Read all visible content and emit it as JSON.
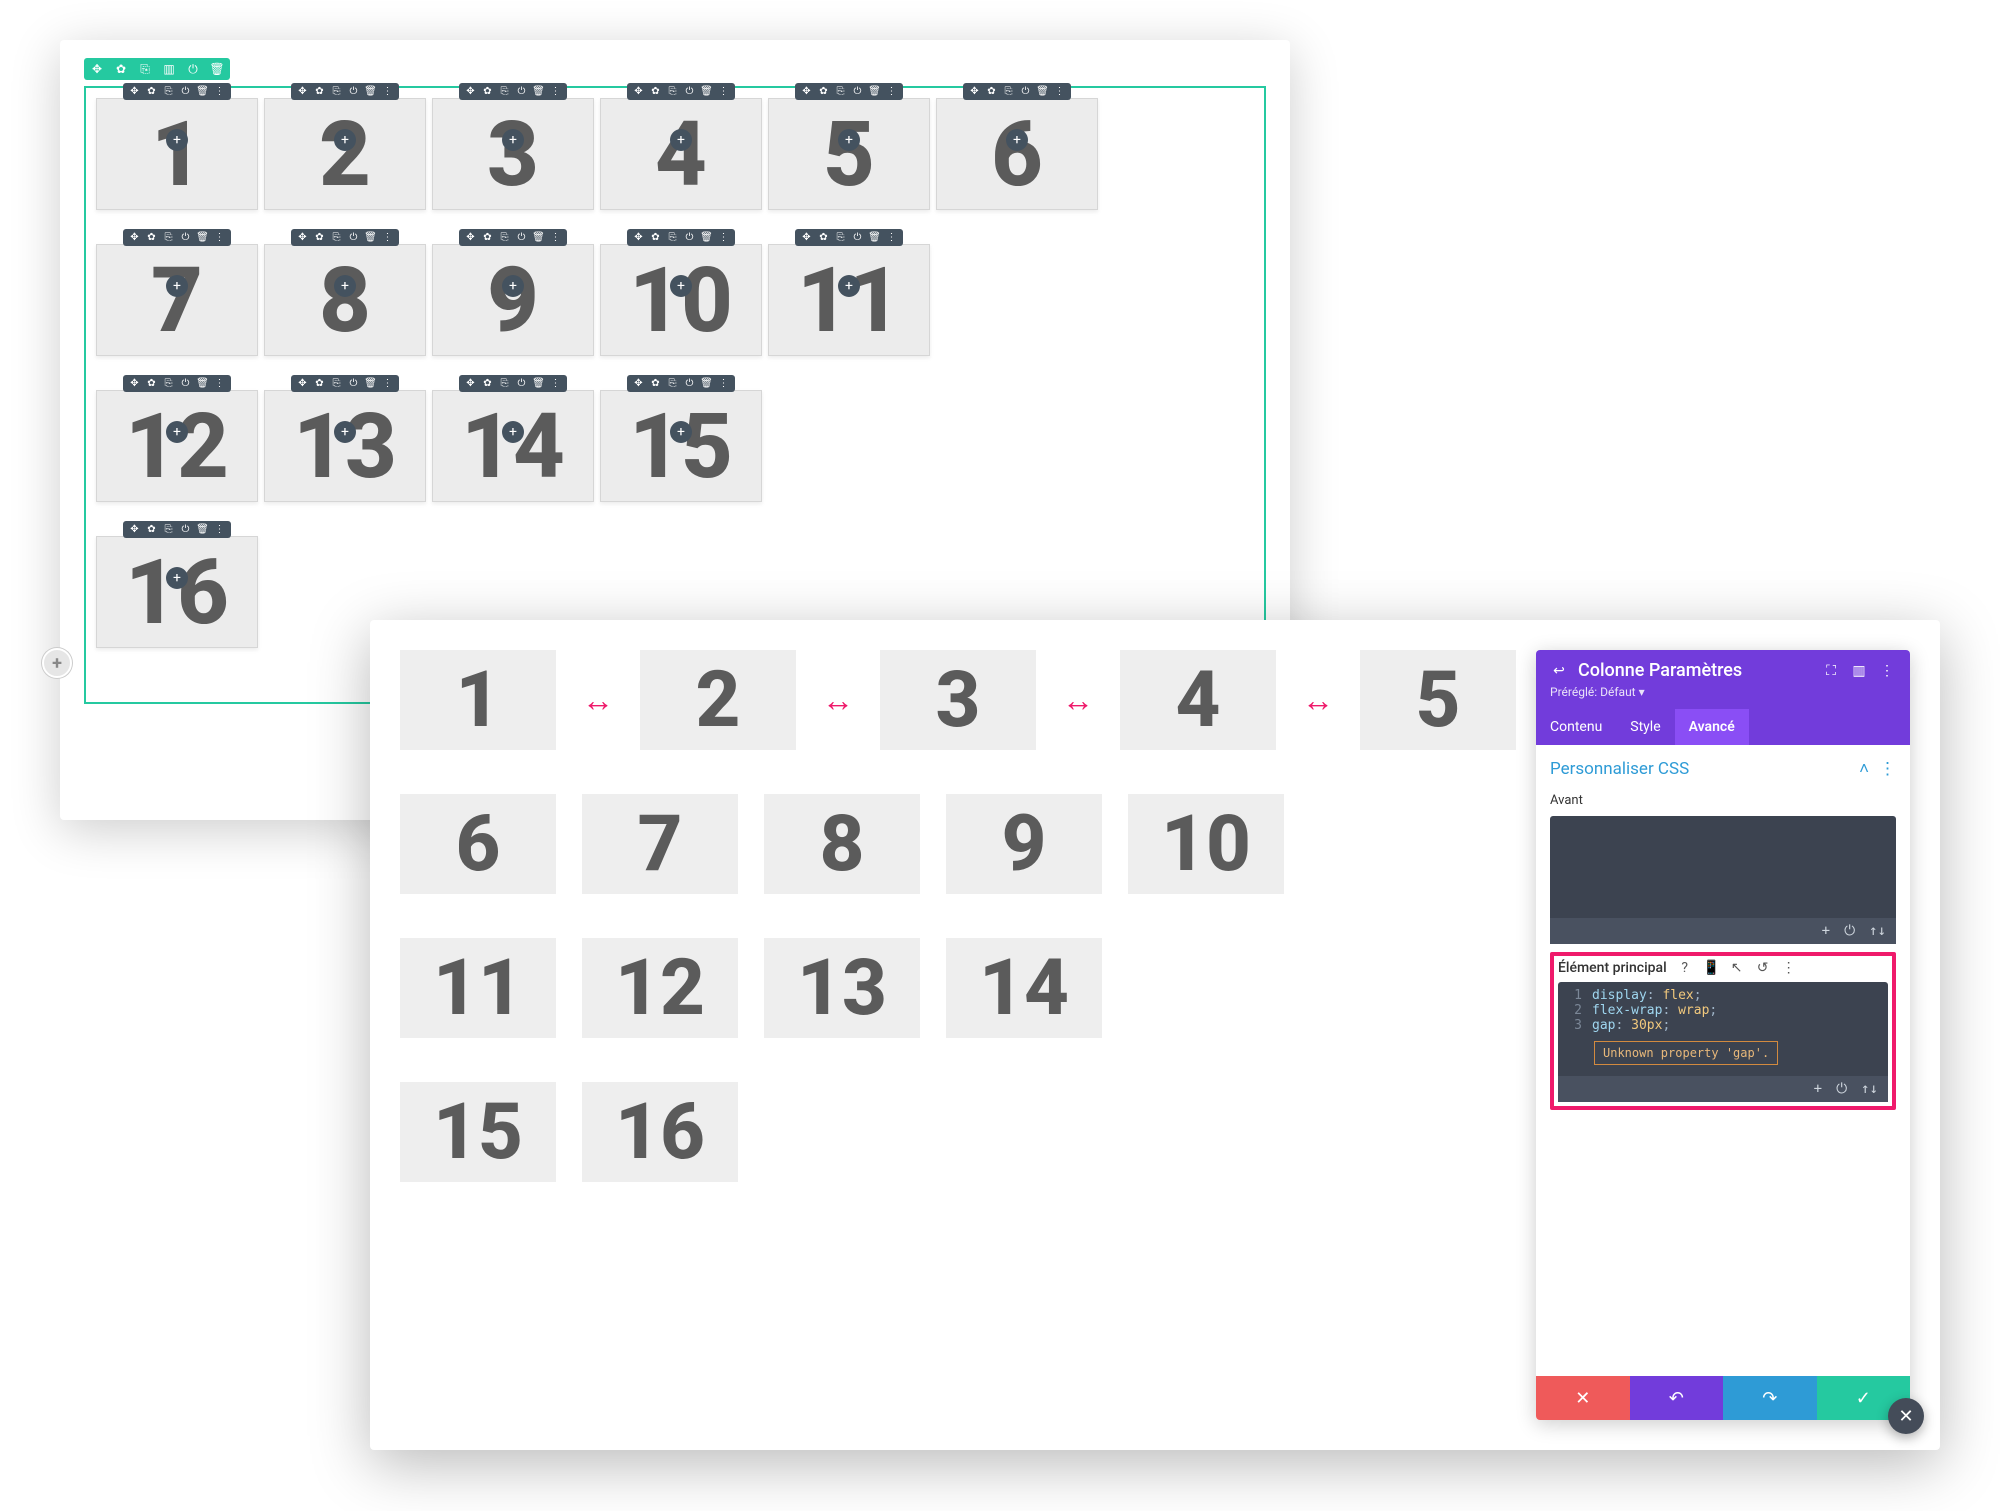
{
  "panel1": {
    "section_toolbar_icons": [
      "✥",
      "✿",
      "⎘",
      "▥",
      "⏻",
      "🗑"
    ],
    "row_toolbar_icons": [
      "✥",
      "✿",
      "⎘",
      "⏻",
      "🗑",
      "⋮"
    ],
    "add_dot": "+",
    "edge_dot": "+",
    "rows": [
      {
        "items": [
          "1",
          "2",
          "3",
          "4",
          "5",
          "6"
        ]
      },
      {
        "items": [
          "7",
          "8",
          "9",
          "10",
          "11"
        ]
      },
      {
        "items": [
          "12",
          "13",
          "14",
          "15"
        ]
      },
      {
        "items": [
          "16"
        ]
      }
    ]
  },
  "panel2": {
    "arrow": "↔",
    "rows": [
      {
        "items": [
          "1",
          "2",
          "3",
          "4",
          "5"
        ],
        "with_arrows": true
      },
      {
        "items": [
          "6",
          "7",
          "8",
          "9",
          "10"
        ],
        "with_arrows": false
      },
      {
        "items": [
          "11",
          "12",
          "13",
          "14"
        ],
        "with_arrows": false
      },
      {
        "items": [
          "15",
          "16"
        ],
        "with_arrows": false
      }
    ]
  },
  "sidebar": {
    "back_icon": "↩",
    "title": "Colonne Paramètres",
    "head_icons": [
      "⛶",
      "▥",
      "⋮"
    ],
    "preset_label": "Préréglé:",
    "preset_value": "Défaut",
    "preset_caret": "▾",
    "tabs": [
      {
        "label": "Contenu",
        "active": false
      },
      {
        "label": "Style",
        "active": false
      },
      {
        "label": "Avancé",
        "active": true
      }
    ],
    "section_title": "Personnaliser CSS",
    "section_collapse": "˄",
    "section_more": "⋮",
    "field_avant": "Avant",
    "code_footer_icons": [
      "+",
      "⏻",
      "↑↓"
    ],
    "element_principal": {
      "label": "Élément principal",
      "icons": [
        "?",
        "📱",
        "↖",
        "↺",
        "⋮"
      ],
      "lines": [
        {
          "n": "1",
          "prop": "display",
          "sep": ": ",
          "val": "flex",
          "end": ";"
        },
        {
          "n": "2",
          "prop": "flex-wrap",
          "sep": ": ",
          "val": "wrap",
          "end": ";"
        },
        {
          "n": "3",
          "prop": "gap",
          "sep": ": ",
          "val": "30px",
          "end": ";"
        }
      ],
      "error": "Unknown property 'gap'."
    },
    "actions": {
      "cancel": "✕",
      "undo": "↶",
      "redo": "↷",
      "save": "✓"
    },
    "discard_fab": "✕"
  }
}
